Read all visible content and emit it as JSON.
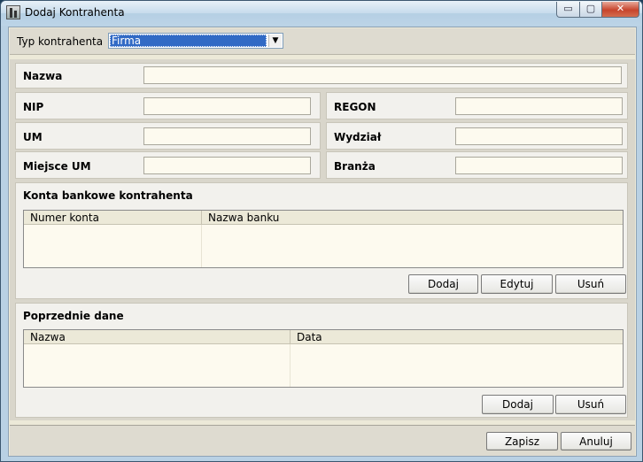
{
  "window": {
    "title": "Dodaj Kontrahenta",
    "controls": {
      "minimize": "▭",
      "maximize": "▢",
      "close": "✕"
    }
  },
  "type_bar": {
    "label": "Typ kontrahenta",
    "selected": "Firma"
  },
  "fields": {
    "nazwa": {
      "label": "Nazwa",
      "value": ""
    },
    "nip": {
      "label": "NIP",
      "value": ""
    },
    "regon": {
      "label": "REGON",
      "value": ""
    },
    "um": {
      "label": "UM",
      "value": ""
    },
    "wydzial": {
      "label": "Wydział",
      "value": ""
    },
    "miejsce_um": {
      "label": "Miejsce UM",
      "value": ""
    },
    "branza": {
      "label": "Branża",
      "value": ""
    }
  },
  "bank_accounts": {
    "title": "Konta bankowe kontrahenta",
    "columns": [
      "Numer konta",
      "Nazwa banku"
    ],
    "rows": [],
    "buttons": {
      "add": "Dodaj",
      "edit": "Edytuj",
      "delete": "Usuń"
    }
  },
  "previous_data": {
    "title": "Poprzednie dane",
    "columns": [
      "Nazwa",
      "Data"
    ],
    "rows": [],
    "buttons": {
      "add": "Dodaj",
      "delete": "Usuń"
    }
  },
  "footer": {
    "save": "Zapisz",
    "cancel": "Anuluj"
  },
  "colors": {
    "selection": "#316ac5",
    "grid_background": "#fdfaef",
    "panel": "#f2f1ed"
  }
}
